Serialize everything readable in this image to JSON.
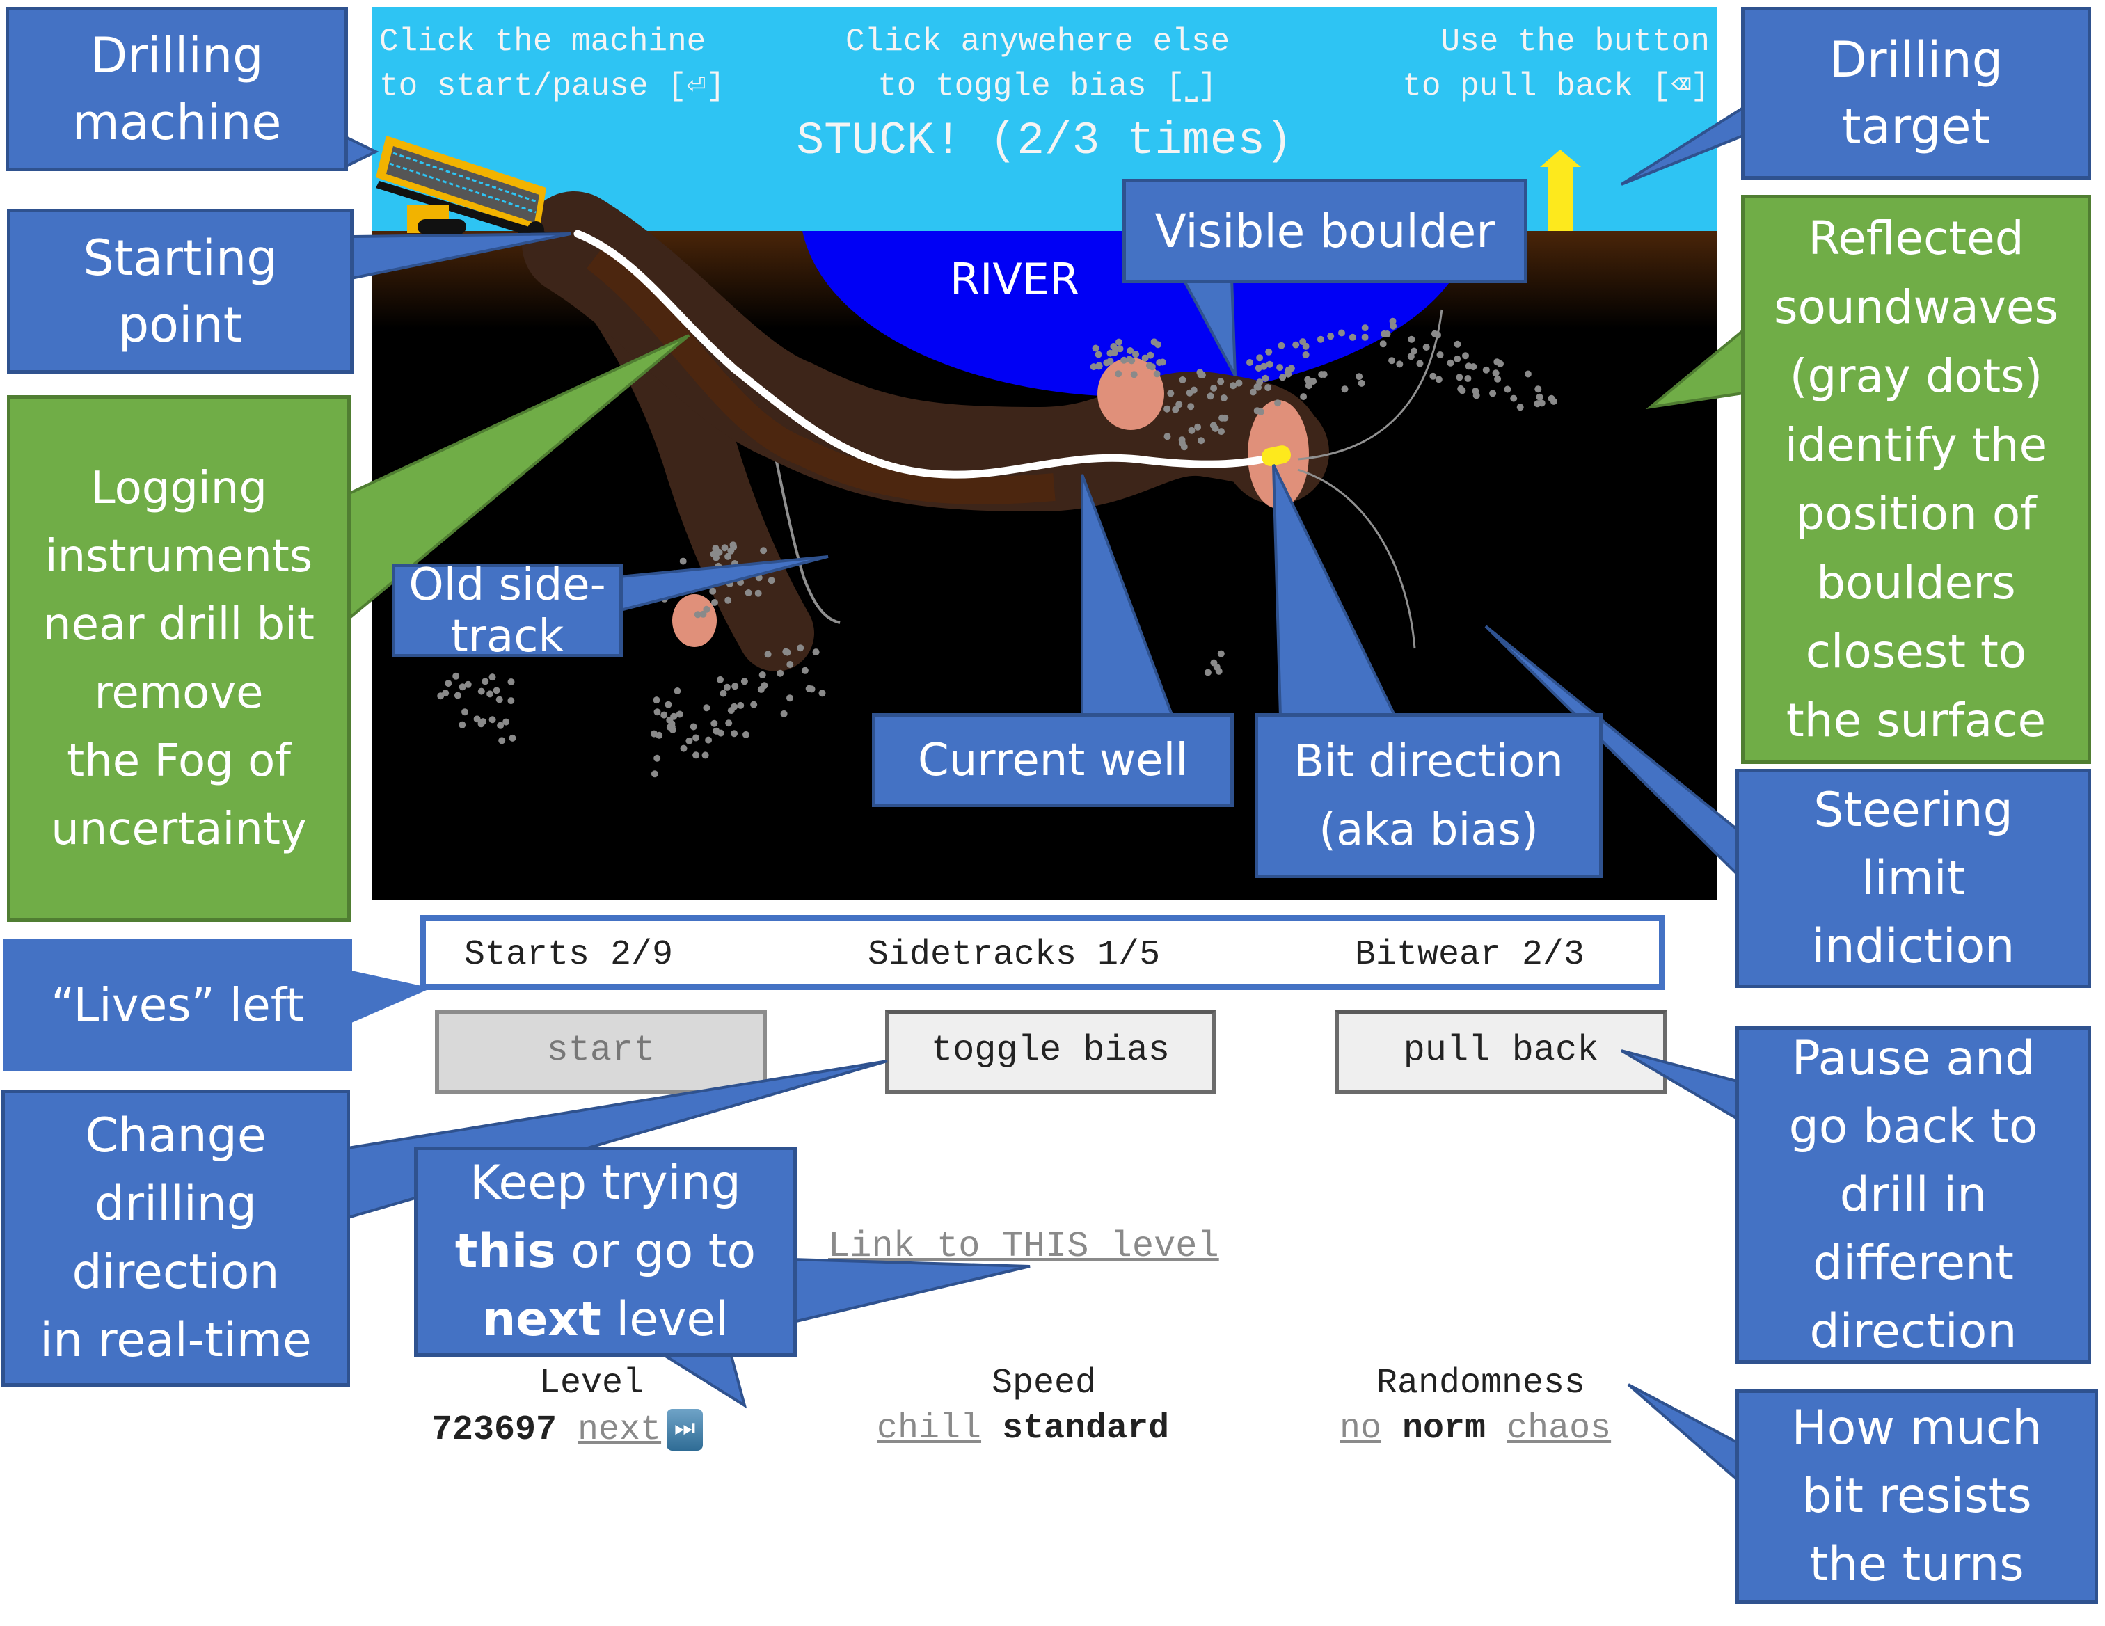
{
  "game": {
    "hints": [
      {
        "line1": "Click the machine",
        "line2": "to start/pause [⏎]"
      },
      {
        "line1": "Click anywehere else",
        "line2": "to toggle bias [⎵]"
      },
      {
        "line1": "Use the button",
        "line2": "to pull back [⌫]"
      }
    ],
    "status": "STUCK! (2/3 times)",
    "river_label": "RIVER",
    "colors": {
      "sky": "#2ec4f3",
      "ground_top": "#4a2509",
      "underground": "#000000",
      "river": "#0000f5",
      "well_tunnel": "#3d2519",
      "well_tunnel_light": "#52270c",
      "well_line": "#ffffff",
      "boulder": "#e0907a",
      "drill_bit": "#fde91d",
      "target": "#fde91d",
      "sound_dots": "#8a8a8a",
      "steer_limit": "#909090"
    },
    "icons": {
      "machine": "drilling-machine-icon",
      "target": "target-house-arrow-icon",
      "bit": "drill-bit-icon"
    }
  },
  "stats": {
    "starts": "Starts 2/9",
    "sidetracks": "Sidetracks 1/5",
    "bitwear": "Bitwear 2/3"
  },
  "buttons": {
    "start": "start",
    "toggle_bias": "toggle bias",
    "pull_back": "pull back"
  },
  "links": {
    "this_level": "Link to THIS level"
  },
  "settings": {
    "level": {
      "label": "Level",
      "value": "723697",
      "next": "next",
      "next_icon": "⏭"
    },
    "speed": {
      "label": "Speed",
      "options": [
        "chill",
        "standard"
      ],
      "selected": "standard"
    },
    "randomness": {
      "label": "Randomness",
      "options": [
        "no",
        "norm",
        "chaos"
      ],
      "selected": "norm"
    }
  },
  "annotations": {
    "drilling_machine": "Drilling\nmachine",
    "starting_point": "Starting\npoint",
    "logging": "Logging\ninstruments\nnear drill bit\nremove\nthe Fog of\nuncertainty",
    "lives_left": "“Lives” left",
    "change_direction": "Change\ndrilling\ndirection\nin real-time",
    "keep_trying_a": "Keep trying",
    "keep_trying_b_bold": "this",
    "keep_trying_b": " or go to",
    "keep_trying_c_bold": "next",
    "keep_trying_c": " level",
    "old_sidetrack": "Old side-track",
    "visible_boulder": "Visible boulder",
    "current_well": "Current well",
    "bit_direction": "Bit direction\n(aka bias)",
    "drilling_target": "Drilling\ntarget",
    "reflected": "Reflected\nsoundwaves\n(gray dots)\nidentify the\nposition of\nboulders\nclosest to\nthe surface",
    "steering_limit": "Steering\nlimit\nindiction",
    "pause_go_back": "Pause and\ngo back to\ndrill in\ndifferent\ndirection",
    "bit_resists": "How much\nbit resists\nthe turns"
  }
}
